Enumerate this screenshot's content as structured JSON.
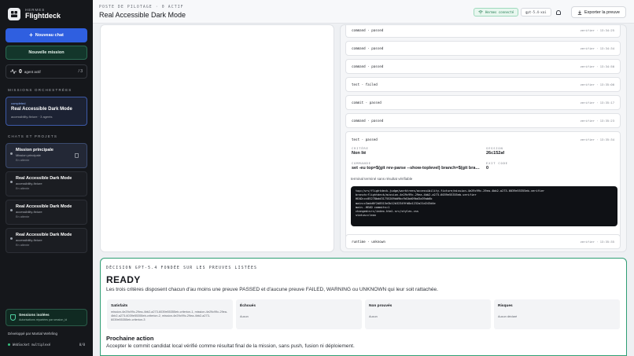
{
  "app": {
    "brand_small": "HERMES",
    "brand_name": "Flightdeck"
  },
  "sidebar": {
    "new_chat": "Nouveau chat",
    "new_mission": "Nouvelle mission",
    "agents": {
      "count": "0",
      "label": "agent actif",
      "ratio": "/ 3"
    },
    "missions_label": "MISSIONS ORCHESTRÉES",
    "mission": {
      "status": "completed",
      "title": "Real Accessible Dark Mode",
      "sub": "accessibility-fixture · 3 agents"
    },
    "chats_label": "CHATS ET PROJETS",
    "chats": [
      {
        "title": "Mission principale",
        "sub": "Mission principale",
        "status": "En attente"
      },
      {
        "title": "Real Accessible Dark Mode",
        "sub": "accessibility-fixture",
        "status": "En attente"
      },
      {
        "title": "Real Accessible Dark Mode",
        "sub": "accessibility-fixture",
        "status": "En attente"
      },
      {
        "title": "Real Accessible Dark Mode",
        "sub": "accessibility-fixture",
        "status": "En attente"
      }
    ],
    "session": {
      "title": "Sessions isolées",
      "sub": "Autorisations répartées par session_id"
    },
    "dev_by": "Développé par Martial Wehrling",
    "ws": {
      "label": "WebSocket multiplexé",
      "value": "0/0"
    }
  },
  "header": {
    "small": "POSTE DE PILOTAGE · 0 ACTIF",
    "title": "Real Accessible Dark Mode",
    "connected": "Hermes connecté",
    "model": "gpt-5.4-xai",
    "export": "Exporter la preuve"
  },
  "steps": [
    {
      "label": "command · passed",
      "meta": "verifier · 13:34:25"
    },
    {
      "label": "command · passed",
      "meta": "verifier · 13:34:34"
    },
    {
      "label": "command · passed",
      "meta": "verifier · 13:34:50"
    },
    {
      "label": "test · failed",
      "meta": "verifier · 13:35:00"
    },
    {
      "label": "commit · passed",
      "meta": "verifier · 13:35:17"
    },
    {
      "label": "command · passed",
      "meta": "verifier · 13:35:23"
    }
  ],
  "detail": {
    "head": "test · passed",
    "time": "verifier · 13:35:34",
    "critere_label": "CRITÈRE",
    "critere_value": "Non lié",
    "session_label": "SESSION",
    "session_value": "26c152af",
    "commande_label": "COMMANDE",
    "commande_value": "set -eu top=$(git rev-parse --show-toplevel) branch=$(git branch --show-current)",
    "exit_label": "EXIT CODE",
    "exit_value": "0",
    "note": "terminal terminé sans résultat vérifiable",
    "terminal": "top=/srv/flightdeck-judge/worktrees/accessibility-fixture/mission-4e29c99c-29ea-4bb2-a273-6039e55355eb-verifier\nbranch=flightdeck/mission-4e29c99c-29ea-4bb2-a273-6039e55355eb-verifier\nHEAD=cc05278bdd31755209dd9bc9d1bd09bd3a39ab6b\nmain=c3add6f2d8515e3b12b32349fd8a1232a21d243d4e\nmain..HEAD commits=1\nchanged=src/index.html.src/styles.css\nstatus=clean"
  },
  "runtime": {
    "label": "runtime · unknown",
    "meta": "verifier · 13:35:35"
  },
  "decision": {
    "label": "DÉCISION GPT-5.4 FONDÉE SUR LES PREUVES LISTÉES",
    "status": "READY",
    "desc": "Les trois critères disposent chacun d'au moins une preuve PASSED et d'aucune preuve FAILED, WARNING ou UNKNOWN qui leur soit rattachée.",
    "cards": [
      {
        "title": "Satisfaits",
        "value": "mission-4e29c99c-29ea-4bb2-a273-6039e55355eb-criterion-1, mission-4e29c99c-29ea-4bb2-a273-6039e55355eb-criterion-2, mission-4e29c99c-29ea-4bb2-a273-6039e55355eb-criterion-3"
      },
      {
        "title": "Échoués",
        "value": "Aucun"
      },
      {
        "title": "Non prouvés",
        "value": "Aucun"
      },
      {
        "title": "Risques",
        "value": "Aucun déclaré"
      }
    ],
    "next_title": "Prochaine action",
    "next_desc": "Accepter le commit candidat local vérifié comme résultat final de la mission, sans push, fusion ni déploiement."
  },
  "colors": {
    "accent": "#2f5fe0",
    "success": "#2f9e74",
    "sidebar": "#15171b"
  },
  "icons": [
    "logo-icon",
    "plus-icon",
    "pulse-icon",
    "trash-icon",
    "shield-icon",
    "bell-icon",
    "download-icon",
    "wifi-icon"
  ]
}
